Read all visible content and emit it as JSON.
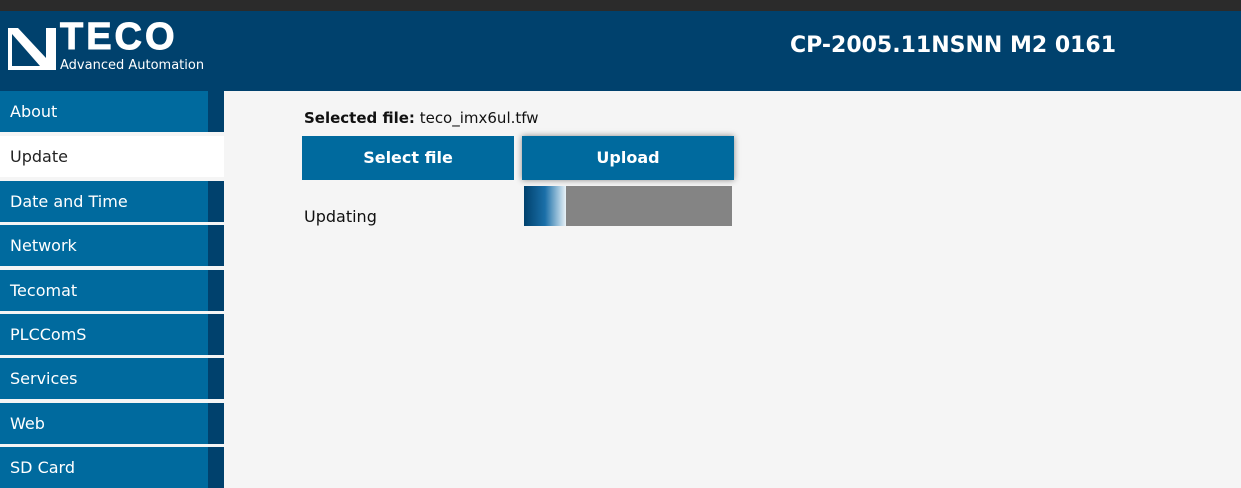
{
  "header": {
    "logo_text": "TECO",
    "logo_subtitle": "Advanced Automation",
    "device_title": "CP-2005.11NSNN M2 0161"
  },
  "sidebar": {
    "items": [
      {
        "label": "About"
      },
      {
        "label": "Update",
        "active": true
      },
      {
        "label": "Date and Time"
      },
      {
        "label": "Network"
      },
      {
        "label": "Tecomat"
      },
      {
        "label": "PLCComS"
      },
      {
        "label": "Services"
      },
      {
        "label": "Web"
      },
      {
        "label": "SD Card"
      }
    ]
  },
  "update": {
    "selected_file_label": "Selected file:",
    "selected_file_name": "teco_imx6ul.tfw",
    "select_button": "Select file",
    "upload_button": "Upload",
    "status": "Updating",
    "progress_fraction": 0.2
  },
  "colors": {
    "header_bg": "#00416d",
    "nav_bg": "#006a9e",
    "button_bg": "#006a9e",
    "progress_track": "#848484"
  }
}
